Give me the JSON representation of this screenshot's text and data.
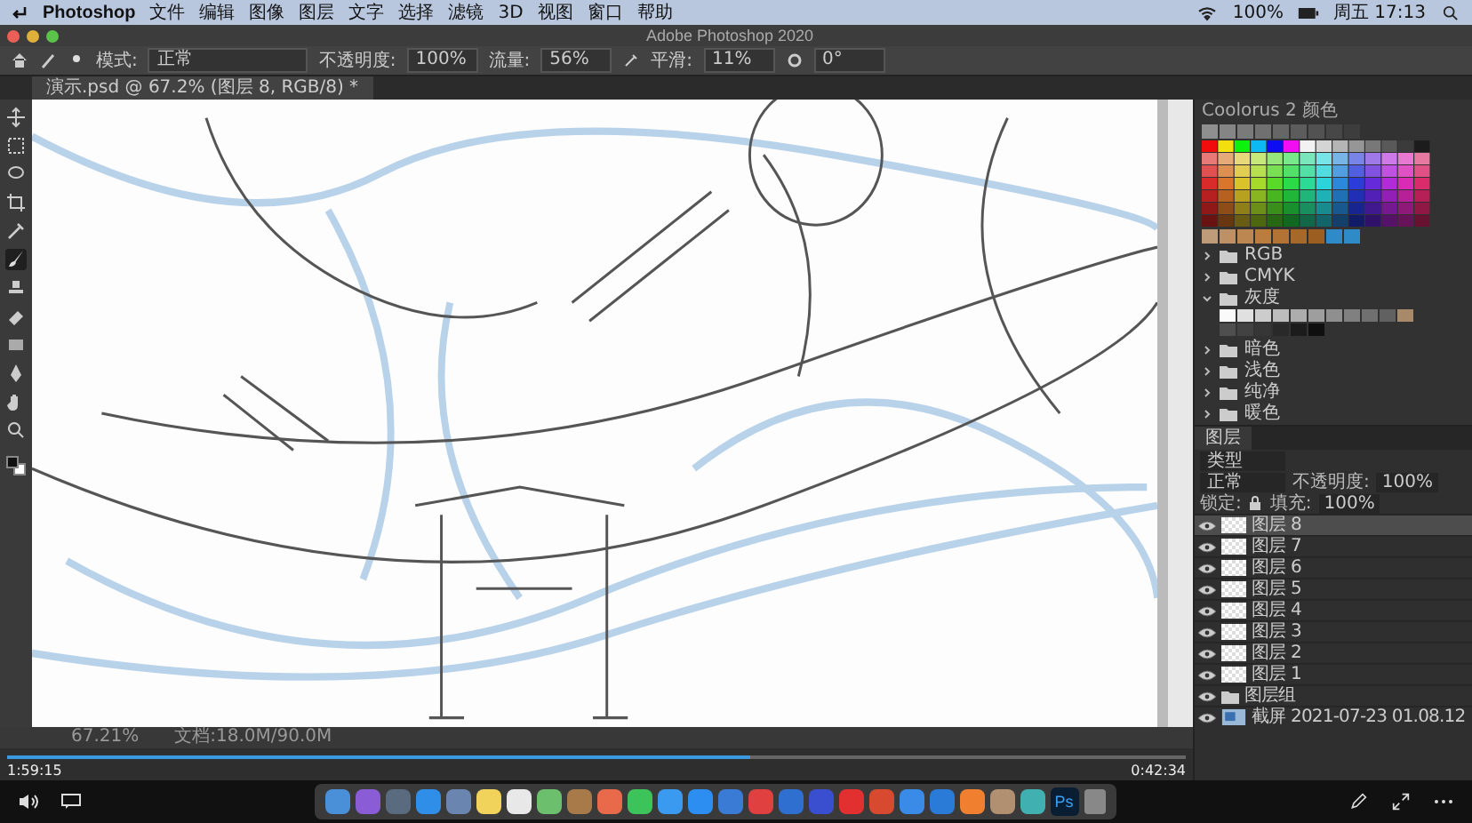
{
  "menu_bar": {
    "app": "Photoshop",
    "items": [
      "文件",
      "编辑",
      "图像",
      "图层",
      "文字",
      "选择",
      "滤镜",
      "3D",
      "视图",
      "窗口",
      "帮助"
    ],
    "battery": "100%",
    "clock": "周五 17:13"
  },
  "window": {
    "title": "Adobe Photoshop 2020"
  },
  "options_bar": {
    "mode_label": "模式:",
    "mode": "正常",
    "opacity_label": "不透明度:",
    "opacity": "100%",
    "flow_label": "流量:",
    "flow": "56%",
    "smoothing_label": "平滑:",
    "smoothing": "11%",
    "angle": "0°"
  },
  "document_tab": {
    "title": "演示.psd @ 67.2% (图层 8, RGB/8) *"
  },
  "toolbar": {
    "tools": [
      {
        "kind": "move",
        "selected": false
      },
      {
        "kind": "marquee",
        "selected": false
      },
      {
        "kind": "lasso",
        "selected": false
      },
      {
        "kind": "crop",
        "selected": false
      },
      {
        "kind": "eyedropper",
        "selected": false
      },
      {
        "kind": "brush",
        "selected": true
      },
      {
        "kind": "stamp",
        "selected": false
      },
      {
        "kind": "eraser",
        "selected": false
      },
      {
        "kind": "gradient",
        "selected": false
      },
      {
        "kind": "pen",
        "selected": false
      },
      {
        "kind": "hand",
        "selected": false
      },
      {
        "kind": "zoom",
        "selected": false
      }
    ]
  },
  "color_panel": {
    "title": "Coolorus 2 颜色",
    "swatch_groups": [
      {
        "name": "RGB",
        "expanded": false
      },
      {
        "name": "CMYK",
        "expanded": false
      },
      {
        "name": "灰度",
        "expanded": true
      },
      {
        "name": "暗色",
        "expanded": false
      },
      {
        "name": "浅色",
        "expanded": false
      },
      {
        "name": "纯净",
        "expanded": false
      },
      {
        "name": "暖色",
        "expanded": false
      }
    ]
  },
  "layers_panel": {
    "tab": "图层",
    "filter": "类型",
    "blend_mode": "正常",
    "opacity_label": "不透明度:",
    "opacity": "100%",
    "lock_label": "锁定:",
    "fill_label": "填充:",
    "fill": "100%",
    "layers": [
      {
        "name": "图层 8",
        "kind": "layer",
        "selected": true,
        "visible": true
      },
      {
        "name": "图层 7",
        "kind": "layer",
        "selected": false,
        "visible": true
      },
      {
        "name": "图层 6",
        "kind": "layer",
        "selected": false,
        "visible": true
      },
      {
        "name": "图层 5",
        "kind": "layer",
        "selected": false,
        "visible": true
      },
      {
        "name": "图层 4",
        "kind": "layer",
        "selected": false,
        "visible": true
      },
      {
        "name": "图层 3",
        "kind": "layer",
        "selected": false,
        "visible": true
      },
      {
        "name": "图层 2",
        "kind": "layer",
        "selected": false,
        "visible": true
      },
      {
        "name": "图层 1",
        "kind": "layer",
        "selected": false,
        "visible": true
      },
      {
        "name": "图层组",
        "kind": "group",
        "selected": false,
        "visible": true
      },
      {
        "name": "截屏 2021-07-23 01.08.12",
        "kind": "image",
        "selected": false,
        "visible": true
      }
    ]
  },
  "status_bar": {
    "zoom": "67.21%",
    "document": "文档:18.0M/90.0M"
  },
  "video_player": {
    "elapsed": "1:59:15",
    "remaining": "0:42:34",
    "level": 0.63
  },
  "dock": {
    "apps": [
      {
        "color": "#4a90d9"
      },
      {
        "color": "#8a5cd6"
      },
      {
        "color": "#5a6b80"
      },
      {
        "color": "#2f8fe8"
      },
      {
        "color": "#6a86b0"
      },
      {
        "color": "#f1d25a"
      },
      {
        "color": "#e8e8e8"
      },
      {
        "color": "#6cbf6c"
      },
      {
        "color": "#a87a4a"
      },
      {
        "color": "#e86a4a"
      },
      {
        "color": "#3cc45a"
      },
      {
        "color": "#3a9af0"
      },
      {
        "color": "#2c8ef0"
      },
      {
        "color": "#3a7bd5"
      },
      {
        "color": "#e04040"
      },
      {
        "color": "#2f6fd0"
      },
      {
        "color": "#3a4fd0"
      },
      {
        "color": "#e23030"
      },
      {
        "color": "#d84a30"
      },
      {
        "color": "#3a8ae8"
      },
      {
        "color": "#2a7ad8"
      },
      {
        "color": "#f08030"
      },
      {
        "color": "#b09070"
      },
      {
        "color": "#40b0b0"
      }
    ],
    "photoshop_label": "Ps"
  }
}
